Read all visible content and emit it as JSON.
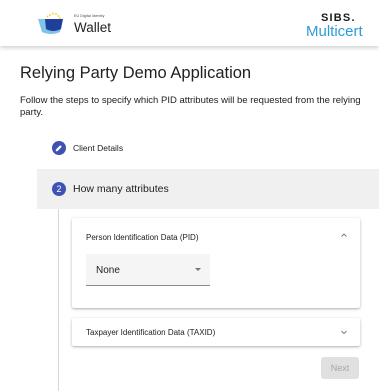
{
  "header": {
    "logo_small_text": "EU Digital Identity",
    "logo_title": "Wallet",
    "partner_brand_top": "SIBS.",
    "partner_brand_bottom": "Multicert"
  },
  "page": {
    "title": "Relying Party Demo Application",
    "intro": "Follow the steps to specify which PID attributes will be requested from the relying party."
  },
  "steps": [
    {
      "number": "",
      "label": "Client Details",
      "state": "completed",
      "icon": "pencil-icon"
    },
    {
      "number": "2",
      "label": "How many attributes",
      "state": "active"
    }
  ],
  "panels": {
    "pid": {
      "title": "Person Identification Data (PID)",
      "expanded": true,
      "select_value": "None"
    },
    "taxid": {
      "title": "Taxpayer Identification Data (TAXID)",
      "expanded": false
    }
  },
  "actions": {
    "next_label": "Next",
    "next_disabled": true
  },
  "colors": {
    "step_accent": "#3f51b5",
    "brand_blue": "#2e9ad8",
    "active_step_bg": "#f0f0f0",
    "disabled_button_bg": "#e0e0e0"
  }
}
